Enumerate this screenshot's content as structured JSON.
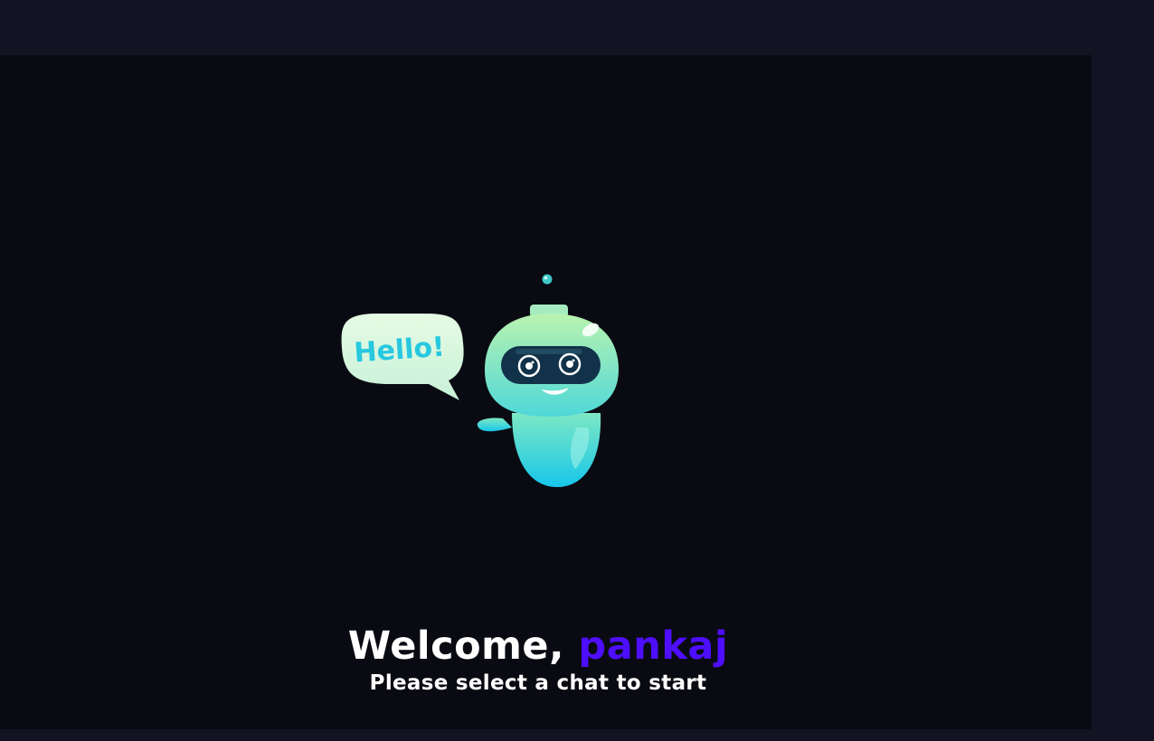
{
  "welcome": {
    "greeting": "Welcome,",
    "username": "pankaj",
    "subtitle": "Please select a chat to start"
  },
  "robot": {
    "speech_bubble_text": "Hello!",
    "icon": "robot-icon"
  },
  "colors": {
    "page_background": "#131324",
    "chat_panel_background": "#0a0b12",
    "username_accent": "#4e0eff",
    "robot_teal": "#2ed3e6",
    "robot_mint": "#a8f0c0"
  }
}
